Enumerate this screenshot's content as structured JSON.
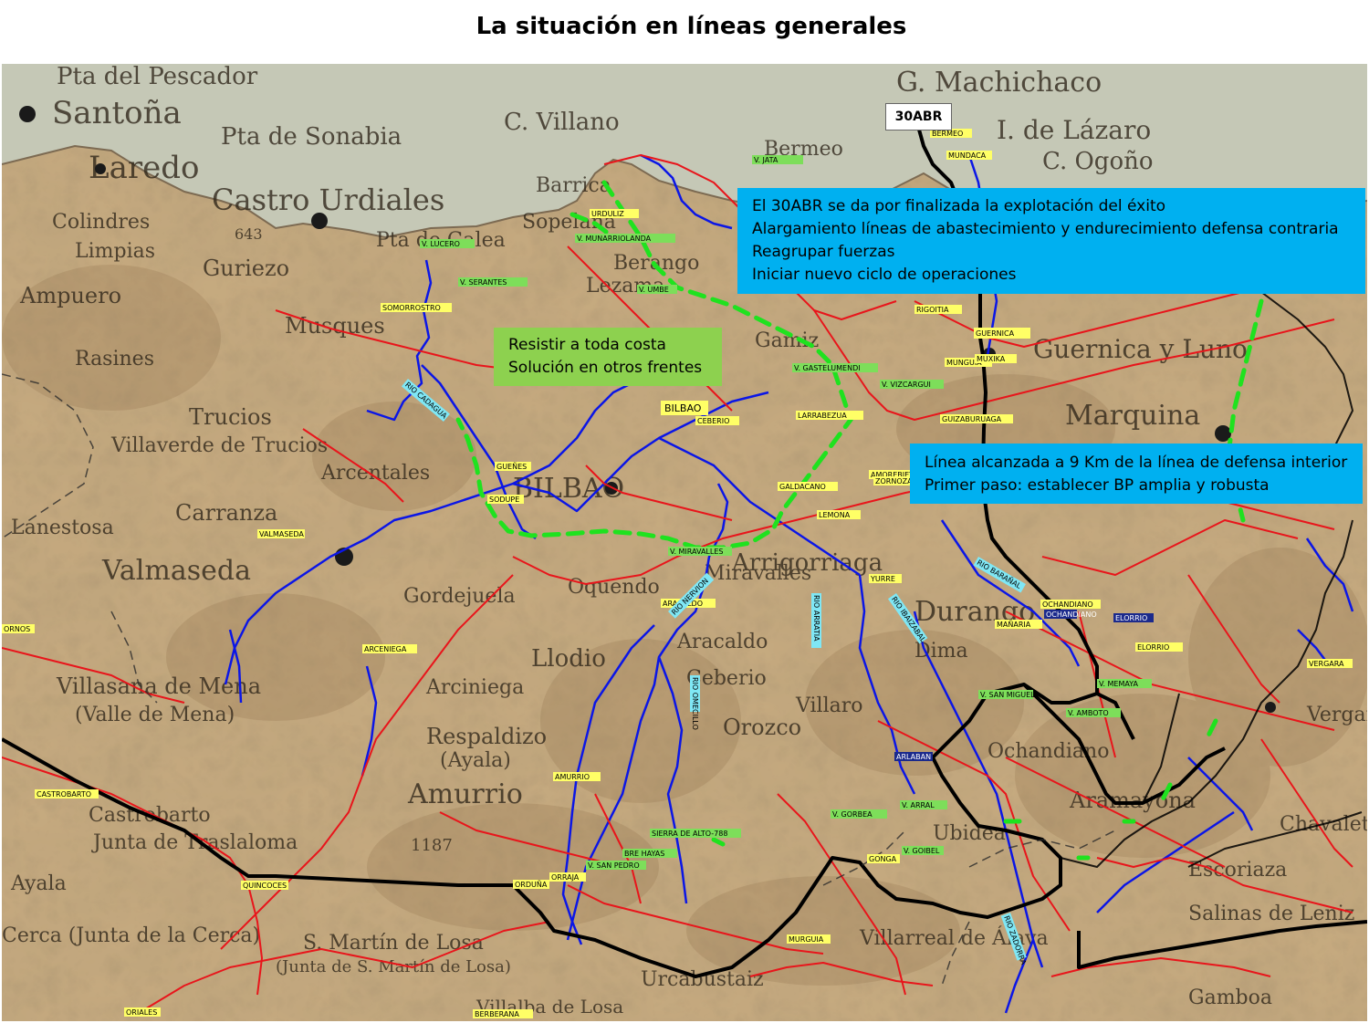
{
  "title": "La situación en líneas generales",
  "date_label": "30ABR",
  "green_box": {
    "lines": [
      "Resistir a toda costa",
      "Solución en otros frentes"
    ]
  },
  "blue_box_1": {
    "lines": [
      "El 30ABR se da por finalizada la explotación del éxito",
      "Alargamiento líneas de abastecimiento y endurecimiento defensa contraria",
      "Reagrupar fuerzas",
      "Iniciar nuevo ciclo de operaciones"
    ]
  },
  "blue_box_2": {
    "lines": [
      "Línea alcanzada a 9 Km de la línea de defensa interior",
      "Primer paso: establecer BP amplia y robusta"
    ]
  },
  "colors": {
    "sea": "#c9cbb9",
    "land": "#cbb28a",
    "roads": "#e8151b",
    "rivers": "#0b16e6",
    "front_line": "#1fe21f",
    "boundary": "#000000",
    "green_box": "#8dd14f",
    "blue_box": "#00b0f0"
  },
  "map_places": [
    {
      "name": "Pta del Pescador",
      "size": 26
    },
    {
      "name": "Santoña",
      "size": 34
    },
    {
      "name": "Pta de Sonabia",
      "size": 26
    },
    {
      "name": "C. Villano",
      "size": 26
    },
    {
      "name": "G. Machichaco",
      "size": 30
    },
    {
      "name": "I. de Lázaro",
      "size": 28
    },
    {
      "name": "C. Ogoño",
      "size": 26
    },
    {
      "name": "Laredo",
      "size": 34
    },
    {
      "name": "Castro Urdiales",
      "size": 32
    },
    {
      "name": "Barrica",
      "size": 22
    },
    {
      "name": "Bermeo",
      "size": 22
    },
    {
      "name": "Colindres",
      "size": 22
    },
    {
      "name": "Limpias",
      "size": 22
    },
    {
      "name": "Guriezo",
      "size": 24
    },
    {
      "name": "Pta de Galea",
      "size": 22
    },
    {
      "name": "Sopelana",
      "size": 22
    },
    {
      "name": "Ampuero",
      "size": 24
    },
    {
      "name": "Musques",
      "size": 24
    },
    {
      "name": "Berango",
      "size": 22
    },
    {
      "name": "Lezama",
      "size": 22
    },
    {
      "name": "Guernica y Luno",
      "size": 28
    },
    {
      "name": "Rasines",
      "size": 22
    },
    {
      "name": "Gamiz",
      "size": 22
    },
    {
      "name": "Marquina",
      "size": 30
    },
    {
      "name": "Trucios",
      "size": 24
    },
    {
      "name": "Villaverde de Trucios",
      "size": 22
    },
    {
      "name": "Arcentales",
      "size": 22
    },
    {
      "name": "BILBAO",
      "size": 30
    },
    {
      "name": "Lanestosa",
      "size": 22
    },
    {
      "name": "Carranza",
      "size": 24
    },
    {
      "name": "Valmaseda",
      "size": 30
    },
    {
      "name": "Arrigorriaga",
      "size": 26
    },
    {
      "name": "Miravalles",
      "size": 22
    },
    {
      "name": "Gordejuela",
      "size": 22
    },
    {
      "name": "Oquendo",
      "size": 22
    },
    {
      "name": "Durango",
      "size": 30
    },
    {
      "name": "Aracaldo",
      "size": 22
    },
    {
      "name": "Llodio",
      "size": 26
    },
    {
      "name": "Ceberio",
      "size": 22
    },
    {
      "name": "Dima",
      "size": 22
    },
    {
      "name": "Villaro",
      "size": 22
    },
    {
      "name": "Villasana de Mena",
      "size": 24
    },
    {
      "name": "(Valle de Mena)",
      "size": 22
    },
    {
      "name": "Arciniega",
      "size": 22
    },
    {
      "name": "Respaldizo",
      "size": 24
    },
    {
      "name": "Orozco",
      "size": 24
    },
    {
      "name": "Amurrio",
      "size": 30
    },
    {
      "name": "(Ayala)",
      "size": 22
    },
    {
      "name": "Ochandiano",
      "size": 22
    },
    {
      "name": "Aramayona",
      "size": 24
    },
    {
      "name": "Castrobarto",
      "size": 22
    },
    {
      "name": "Junta de Traslaloma",
      "size": 22
    },
    {
      "name": "Ubidea",
      "size": 22
    },
    {
      "name": "Escoriaza",
      "size": 22
    },
    {
      "name": "Ayala",
      "size": 22
    },
    {
      "name": "Cerca (Junta de la Cerca)",
      "size": 22
    },
    {
      "name": "Salinas de Leniz",
      "size": 22
    },
    {
      "name": "S. Martín de Losa",
      "size": 22
    },
    {
      "name": "(Junta de S. Martín de Losa)",
      "size": 18
    },
    {
      "name": "Villarreal de Álava",
      "size": 22
    },
    {
      "name": "Urcabustaiz",
      "size": 22
    },
    {
      "name": "Villalba de Losa",
      "size": 20
    },
    {
      "name": "Gamboa",
      "size": 22
    },
    {
      "name": "Vergara",
      "size": 22
    },
    {
      "name": "Chavaleta",
      "size": 22
    },
    {
      "name": "1187",
      "size": 18
    },
    {
      "name": "643",
      "size": 16
    }
  ],
  "map_labels": {
    "yellow": [
      "BILBAO",
      "SOMORROSTRO",
      "ARCENIEGA",
      "AMURRIO",
      "ARACALDO",
      "LEMONA",
      "YURRE",
      "MAÑARIA",
      "AMOREBIETA",
      "LARRABEZUA",
      "GALDACANO",
      "MUNGUIA",
      "URDULIZ",
      "BERMEO",
      "MUNDACA",
      "GUERNICA",
      "GUIZABURUAGA",
      "MURGUIA",
      "OCHANDIANO",
      "VERGARA",
      "ORDUÑA",
      "VALMASEDA",
      "SODUPE",
      "GUEÑES",
      "ZORNOZA",
      "CASTROBARTO",
      "QUINCOCES",
      "ORIALES",
      "BERBERANA",
      "ELORRIO",
      "GONGA",
      "ORRAJA",
      "RIGOITIA",
      "CEBERIO",
      "ORNOS",
      "MUXIKA"
    ],
    "green": [
      "V. JATA",
      "V. LUCERO",
      "V. SERANTES",
      "V. MUNARRIOLANDA",
      "V. UMBE",
      "V. GASTELUMENDI",
      "V. VIZCARGUI",
      "V. GORBEA",
      "V. ARRAL",
      "V. SAN PEDRO",
      "V. MEMAYA",
      "V. AMBOTO",
      "V. GOIBEL",
      "V. SAN MIGUEL",
      "SIERRA DE ALTO-788",
      "BRE HAYAS",
      "V. MIRAVALLES"
    ],
    "cyan": [
      "RIO NERVION",
      "RIO BARAÑAL",
      "RIO IBAIZABAL",
      "RIO ARRATIA",
      "RIO CADAGUA",
      "RIO OMECILLO",
      "RIO ZADORRA"
    ],
    "navy": [
      "OCHANDIANO",
      "ELORRIO",
      "ARLABAN"
    ]
  }
}
